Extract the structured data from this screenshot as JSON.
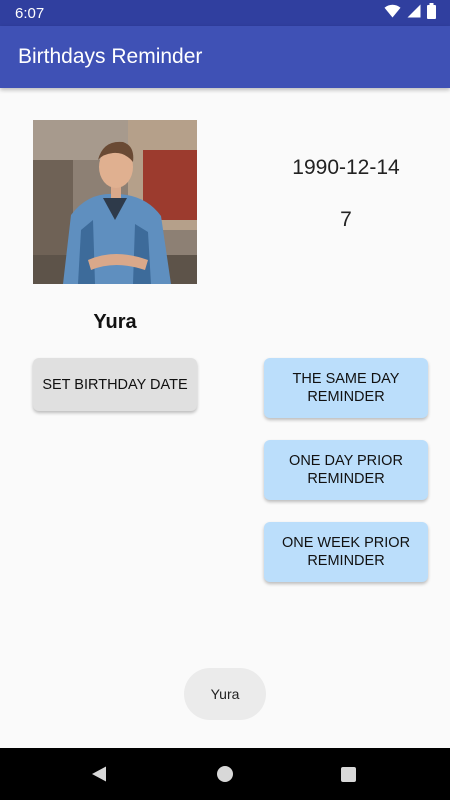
{
  "status_bar": {
    "time": "6:07"
  },
  "app_bar": {
    "title": "Birthdays Reminder"
  },
  "profile": {
    "name": "Yura",
    "birth_date": "1990-12-14",
    "days_value": "7"
  },
  "buttons": {
    "set_birthday": "SET BIRTHDAY DATE",
    "same_day": "THE SAME DAY REMINDER",
    "one_day": "ONE DAY PRIOR REMINDER",
    "one_week": "ONE WEEK PRIOR REMINDER"
  },
  "toast": {
    "text": "Yura"
  },
  "icons": {
    "wifi": "wifi-icon",
    "signal": "signal-icon",
    "battery": "battery-icon",
    "back": "back-icon",
    "home": "home-icon",
    "recents": "recents-icon"
  },
  "colors": {
    "status_bar": "#303f9f",
    "app_bar": "#3f51b5",
    "reminder_button": "#bbdefb",
    "set_button": "#e0e0e0"
  }
}
